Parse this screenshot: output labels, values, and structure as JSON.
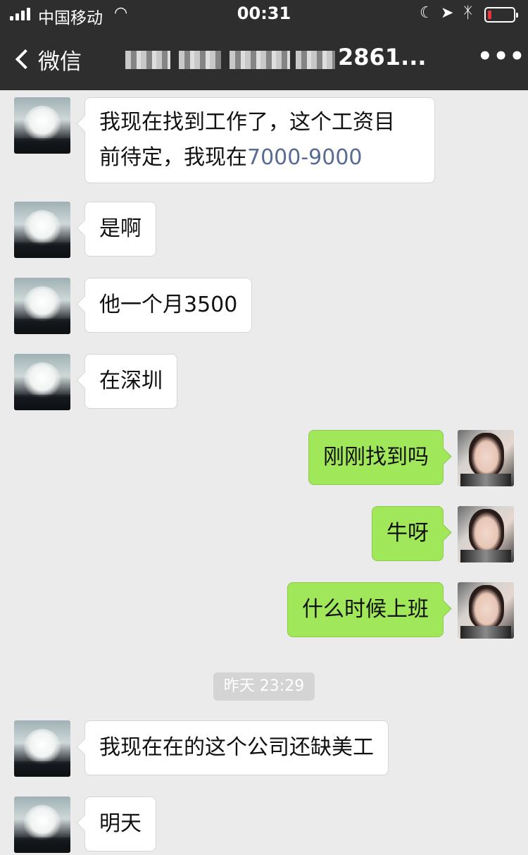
{
  "status_bar": {
    "carrier": "中国移动",
    "time": "00:31",
    "wifi_icon": "wifi-icon",
    "battery_color": "#e8343a"
  },
  "nav": {
    "back_label": "微信",
    "title": "2861...",
    "more_label": "•••"
  },
  "colors": {
    "header_bg": "#2e2e2e",
    "chat_bg": "#ebebeb",
    "bubble_mine": "#a0e75a",
    "bubble_other": "#ffffff",
    "link": "#576b95"
  },
  "messages": [
    {
      "side": "left",
      "line1": "我现在找到工作了，这个工资目",
      "line2_prefix": "前待定，我现在",
      "line2_link": "7000-9000"
    },
    {
      "side": "left",
      "text": "是啊"
    },
    {
      "side": "left",
      "text": "他一个月3500"
    },
    {
      "side": "left",
      "text": "在深圳"
    },
    {
      "side": "right",
      "text": "刚刚找到吗"
    },
    {
      "side": "right",
      "text": "牛呀"
    },
    {
      "side": "right",
      "text": "什么时候上班"
    },
    {
      "side": "left",
      "text": "我现在在的这个公司还缺美工"
    },
    {
      "side": "left",
      "text": "明天"
    }
  ],
  "timestamp": "昨天 23:29"
}
